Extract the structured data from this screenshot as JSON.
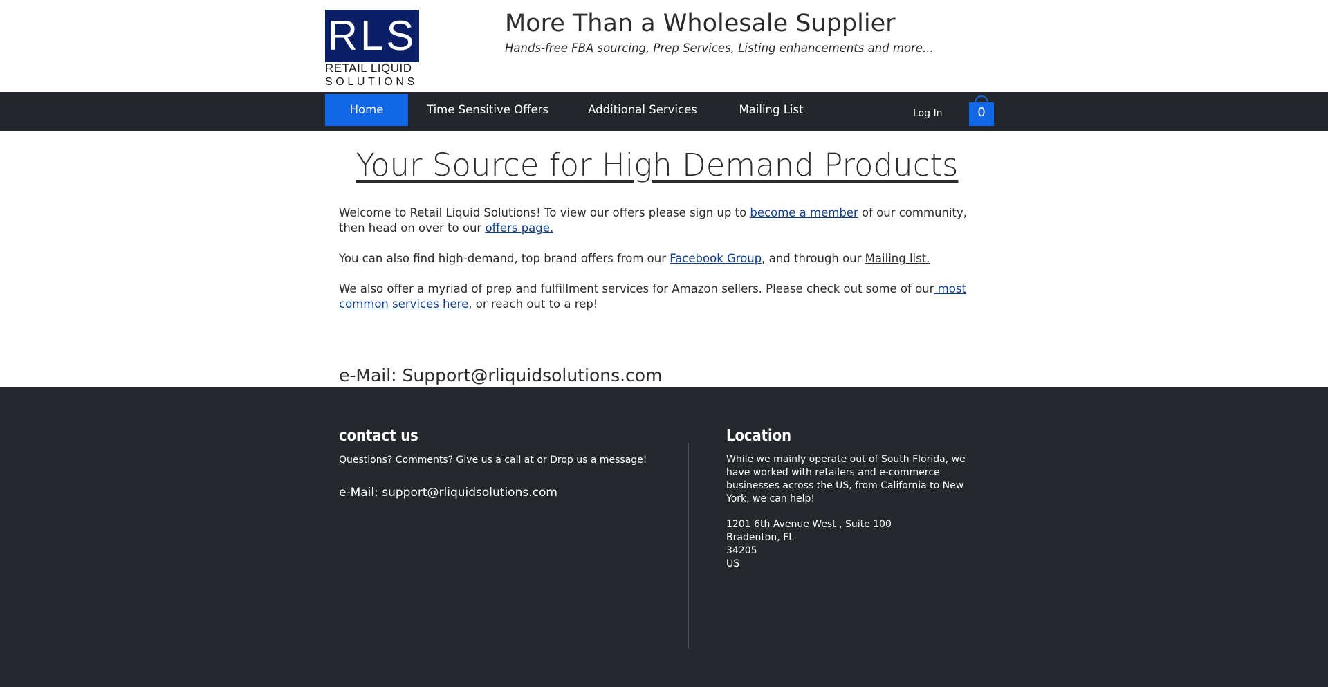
{
  "header": {
    "logo": {
      "letters": "RLS",
      "line1": "RETAIL LIQUID",
      "line2": "SOLUTIONS"
    },
    "title": "More Than a Wholesale Supplier",
    "tagline": "Hands-free FBA sourcing, Prep Services, Listing enhancements and more..."
  },
  "nav": {
    "items": [
      {
        "label": "Home"
      },
      {
        "label": "Time Sensitive Offers"
      },
      {
        "label": "Additional Services"
      },
      {
        "label": "Mailing List"
      }
    ],
    "login_label": "Log In",
    "cart_count": "0"
  },
  "main": {
    "heading": "Your Source for High Demand Products",
    "p1": {
      "t1": "Welcome to Retail Liquid Solutions! To view our offers please sign up to ",
      "link1": "become a member",
      "t2": " of our community, then head on over to our ",
      "link2": "offers page."
    },
    "p2": {
      "t1": "You can also find high-demand, top brand offers from our ",
      "link1": "Facebook Group",
      "t2": ", and through our ",
      "link2": "Mailing list."
    },
    "p3": {
      "t1": "We also offer a myriad of prep and fulfillment services for Amazon sellers. Please check out some of our",
      "link1": " most common services here",
      "t2": ", or reach out to a rep!"
    },
    "email": "e-Mail: Support@rliquidsolutions.com"
  },
  "footer": {
    "contact": {
      "heading": "contact us",
      "text": "Questions? Comments? Give us a call at or Drop us a message!",
      "email": "e-Mail: support@rliquidsolutions.com"
    },
    "location": {
      "heading": "Location",
      "text": "While we mainly operate out of South Florida, we have worked with retailers and e-commerce businesses across the US, from California to New York, we can help!",
      "address": [
        "1201 6th Avenue West , Suite 100",
        "Bradenton, FL",
        "34205",
        "US"
      ]
    }
  },
  "colors": {
    "nav_bg": "#23272b",
    "accent": "#1267e7",
    "footer_bg": "#25282d",
    "logo_blue": "#0b1f66",
    "link": "#0b3d91"
  }
}
